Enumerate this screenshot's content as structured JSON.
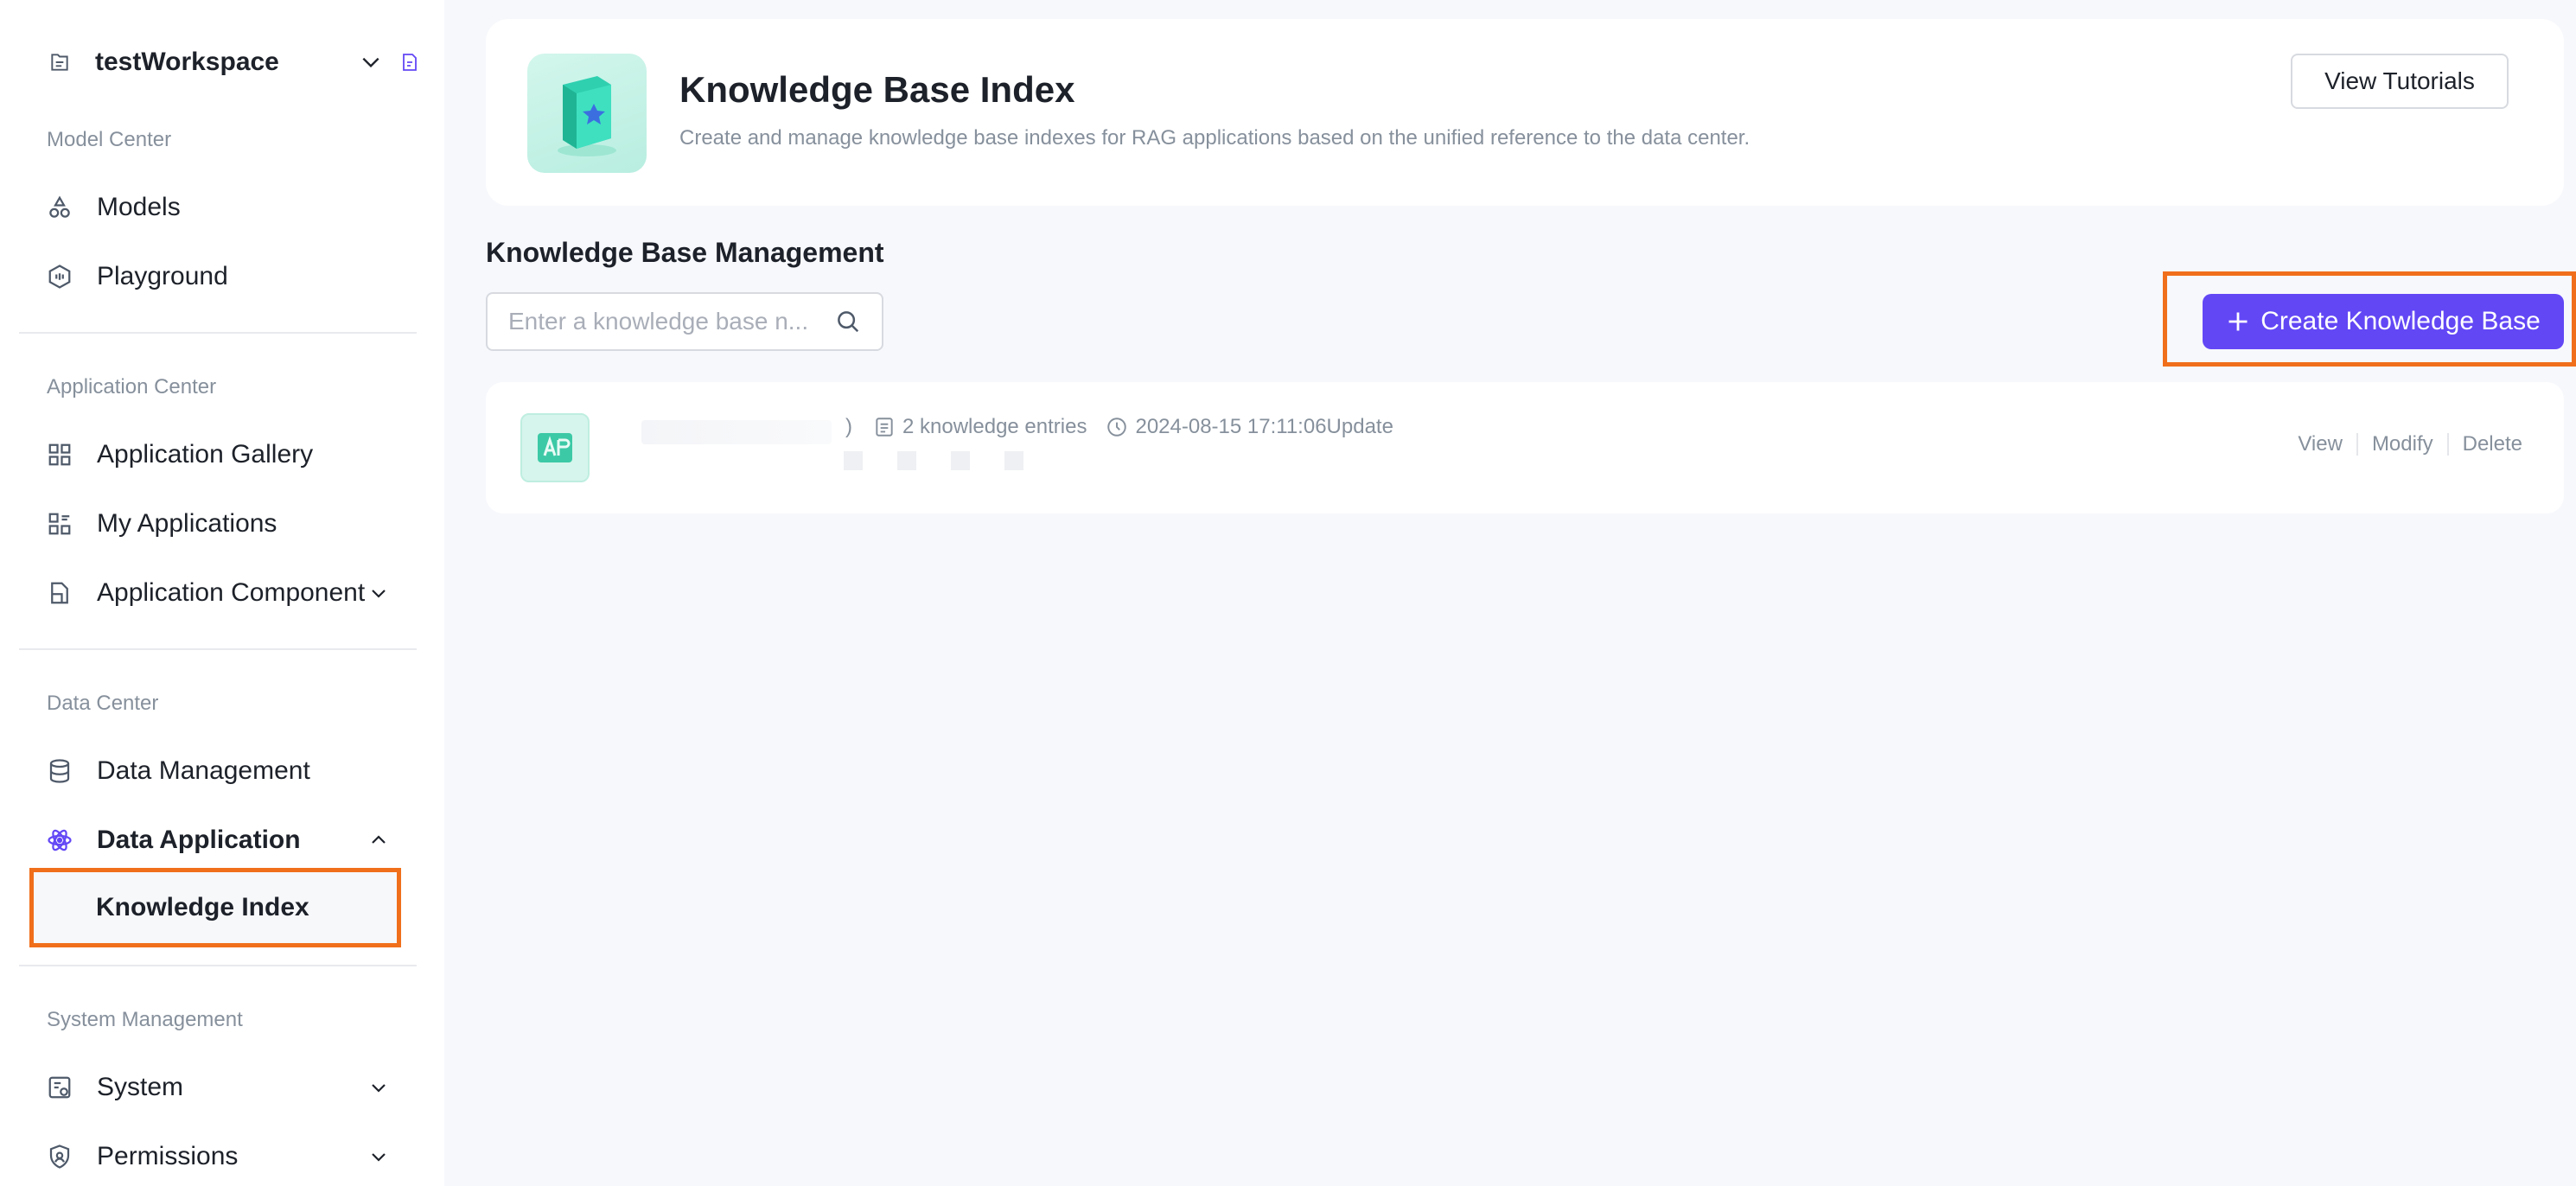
{
  "workspace": {
    "name": "testWorkspace"
  },
  "sidebar": {
    "sections": [
      {
        "title": "Model Center",
        "items": [
          {
            "label": "Models"
          },
          {
            "label": "Playground"
          }
        ]
      },
      {
        "title": "Application Center",
        "items": [
          {
            "label": "Application Gallery"
          },
          {
            "label": "My Applications"
          },
          {
            "label": "Application Component"
          }
        ]
      },
      {
        "title": "Data Center",
        "items": [
          {
            "label": "Data Management"
          },
          {
            "label": "Data Application"
          }
        ],
        "sub_items": [
          {
            "label": "Knowledge Index"
          }
        ]
      },
      {
        "title": "System Management",
        "items": [
          {
            "label": "System"
          },
          {
            "label": "Permissions"
          }
        ]
      }
    ],
    "accent_color": "#6247f5"
  },
  "header": {
    "title": "Knowledge Base Index",
    "description": "Create and manage knowledge base indexes for RAG applications based on the unified reference to the data center.",
    "tutorials_label": "View Tutorials"
  },
  "management": {
    "title": "Knowledge Base Management",
    "search_placeholder": "Enter a knowledge base n...",
    "search_value": "",
    "create_label": "Create Knowledge Base"
  },
  "kb_list": [
    {
      "prefix_char": ")",
      "entries": "2 knowledge entries",
      "updated": "2024-08-15 17:11:06Update",
      "actions": {
        "view": "View",
        "modify": "Modify",
        "delete": "Delete"
      }
    }
  ],
  "colors": {
    "highlight_outline": "#f06f1b",
    "primary": "#6247f5",
    "muted_text": "#86909c"
  }
}
